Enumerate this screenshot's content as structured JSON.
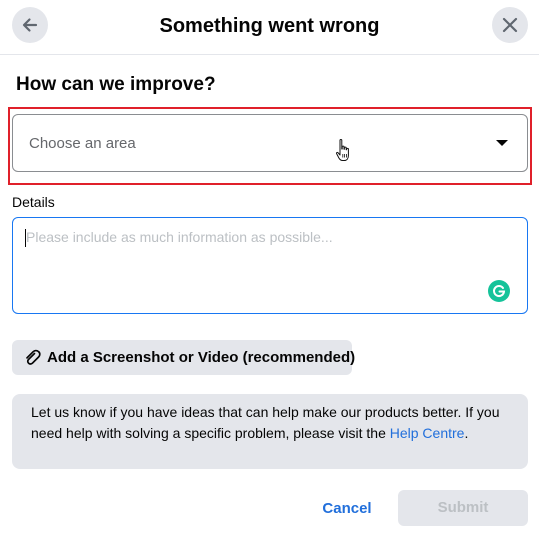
{
  "header": {
    "title": "Something went wrong",
    "back_icon": "arrow-left-icon",
    "close_icon": "close-icon"
  },
  "form": {
    "heading": "How can we improve?",
    "area_select": {
      "placeholder": "Choose an area",
      "selected": ""
    },
    "details_label": "Details",
    "details_placeholder": "Please include as much information as possible...",
    "details_value": "",
    "attach_button_label": "Add a Screenshot or Video (recommended)"
  },
  "info": {
    "text_before_link": "Let us know if you have ideas that can help make our products better. If you need help with solving a specific problem, please visit the ",
    "link_text": "Help Centre",
    "text_after_link": "."
  },
  "footer": {
    "cancel_label": "Cancel",
    "submit_label": "Submit",
    "submit_enabled": false
  },
  "colors": {
    "accent_link": "#216fdb",
    "focus_border": "#1877f2",
    "highlight_border": "#e0202a",
    "button_grey": "#e4e6eb",
    "grammarly_green": "#15c39a"
  }
}
